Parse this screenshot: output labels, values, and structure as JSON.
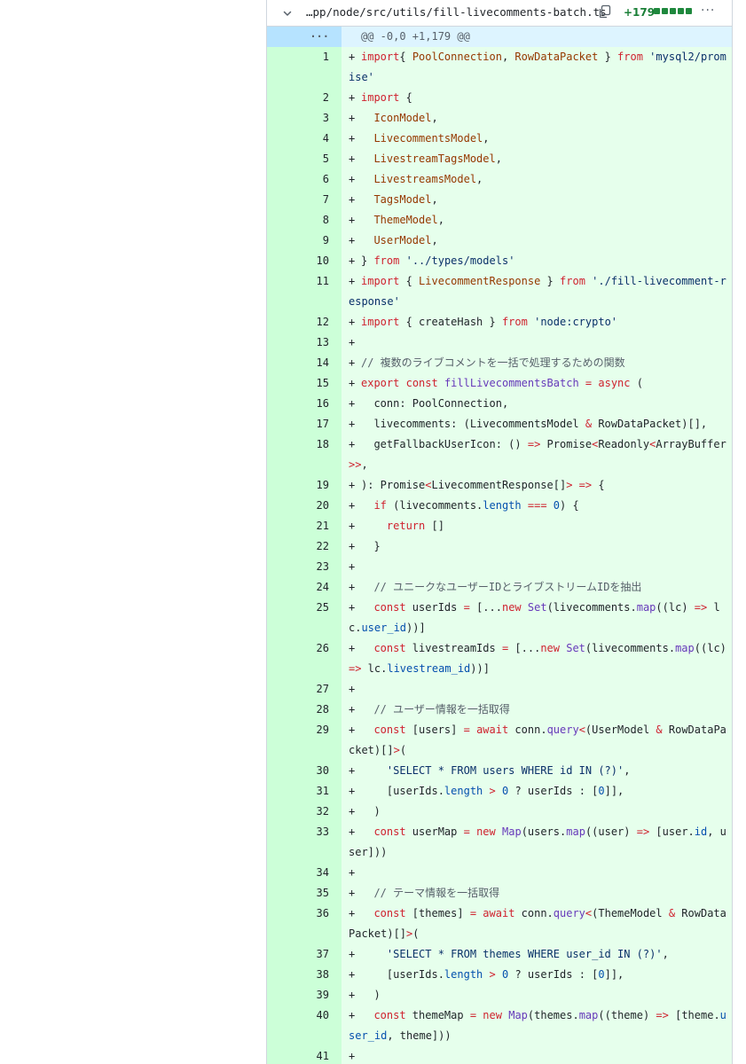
{
  "file": {
    "name": "…pp/node/src/utils/fill-livecomments-batch.ts",
    "additions": "+179",
    "more": "···"
  },
  "hunk": {
    "num": "···",
    "header": "@@ -0,0 +1,179 @@"
  },
  "lines": [
    {
      "n": "1",
      "tokens": [
        [
          "k",
          "import"
        ],
        [
          "",
          "{ "
        ],
        [
          "t",
          "PoolConnection"
        ],
        [
          "",
          ", "
        ],
        [
          "t",
          "RowDataPacket"
        ],
        [
          "",
          " } "
        ],
        [
          "k",
          "from"
        ],
        [
          "",
          " "
        ],
        [
          "s",
          "'mysql2/promise'"
        ]
      ]
    },
    {
      "n": "2",
      "tokens": [
        [
          "k",
          "import"
        ],
        [
          "",
          " {"
        ]
      ]
    },
    {
      "n": "3",
      "tokens": [
        [
          "",
          "  "
        ],
        [
          "t",
          "IconModel"
        ],
        [
          "",
          ","
        ]
      ]
    },
    {
      "n": "4",
      "tokens": [
        [
          "",
          "  "
        ],
        [
          "t",
          "LivecommentsModel"
        ],
        [
          "",
          ","
        ]
      ]
    },
    {
      "n": "5",
      "tokens": [
        [
          "",
          "  "
        ],
        [
          "t",
          "LivestreamTagsModel"
        ],
        [
          "",
          ","
        ]
      ]
    },
    {
      "n": "6",
      "tokens": [
        [
          "",
          "  "
        ],
        [
          "t",
          "LivestreamsModel"
        ],
        [
          "",
          ","
        ]
      ]
    },
    {
      "n": "7",
      "tokens": [
        [
          "",
          "  "
        ],
        [
          "t",
          "TagsModel"
        ],
        [
          "",
          ","
        ]
      ]
    },
    {
      "n": "8",
      "tokens": [
        [
          "",
          "  "
        ],
        [
          "t",
          "ThemeModel"
        ],
        [
          "",
          ","
        ]
      ]
    },
    {
      "n": "9",
      "tokens": [
        [
          "",
          "  "
        ],
        [
          "t",
          "UserModel"
        ],
        [
          "",
          ","
        ]
      ]
    },
    {
      "n": "10",
      "tokens": [
        [
          "",
          "} "
        ],
        [
          "k",
          "from"
        ],
        [
          "",
          " "
        ],
        [
          "s",
          "'../types/models'"
        ]
      ]
    },
    {
      "n": "11",
      "tokens": [
        [
          "k",
          "import"
        ],
        [
          "",
          " { "
        ],
        [
          "t",
          "LivecommentResponse"
        ],
        [
          "",
          " } "
        ],
        [
          "k",
          "from"
        ],
        [
          "",
          " "
        ],
        [
          "s",
          "'./fill-livecomment-response'"
        ]
      ]
    },
    {
      "n": "12",
      "tokens": [
        [
          "k",
          "import"
        ],
        [
          "",
          " { createHash } "
        ],
        [
          "k",
          "from"
        ],
        [
          "",
          " "
        ],
        [
          "s",
          "'node:crypto'"
        ]
      ]
    },
    {
      "n": "13",
      "tokens": []
    },
    {
      "n": "14",
      "tokens": [
        [
          "c",
          "// 複数のライブコメントを一括で処理するための関数"
        ]
      ]
    },
    {
      "n": "15",
      "tokens": [
        [
          "k",
          "export"
        ],
        [
          "",
          " "
        ],
        [
          "k",
          "const"
        ],
        [
          "",
          " "
        ],
        [
          "f",
          "fillLivecommentsBatch"
        ],
        [
          "",
          " "
        ],
        [
          "k",
          "="
        ],
        [
          "",
          " "
        ],
        [
          "k",
          "async"
        ],
        [
          "",
          " ("
        ]
      ]
    },
    {
      "n": "16",
      "tokens": [
        [
          "",
          "  conn: PoolConnection,"
        ]
      ]
    },
    {
      "n": "17",
      "tokens": [
        [
          "",
          "  livecomments: (LivecommentsModel "
        ],
        [
          "k",
          "&"
        ],
        [
          "",
          " RowDataPacket)[],"
        ]
      ]
    },
    {
      "n": "18",
      "tokens": [
        [
          "",
          "  getFallbackUserIcon: () "
        ],
        [
          "k",
          "=>"
        ],
        [
          "",
          " Promise"
        ],
        [
          "k",
          "<"
        ],
        [
          "",
          "Readonly"
        ],
        [
          "k",
          "<"
        ],
        [
          "",
          "ArrayBuffer"
        ],
        [
          "k",
          ">>"
        ],
        [
          "",
          ","
        ]
      ]
    },
    {
      "n": "19",
      "tokens": [
        [
          "",
          "): Promise"
        ],
        [
          "k",
          "<"
        ],
        [
          "",
          "LivecommentResponse[]"
        ],
        [
          "k",
          ">"
        ],
        [
          "",
          " "
        ],
        [
          "k",
          "=>"
        ],
        [
          "",
          " {"
        ]
      ]
    },
    {
      "n": "20",
      "tokens": [
        [
          "",
          "  "
        ],
        [
          "k",
          "if"
        ],
        [
          "",
          " (livecomments."
        ],
        [
          "n",
          "length"
        ],
        [
          "",
          " "
        ],
        [
          "k",
          "==="
        ],
        [
          "",
          " "
        ],
        [
          "n",
          "0"
        ],
        [
          "",
          ") {"
        ]
      ]
    },
    {
      "n": "21",
      "tokens": [
        [
          "",
          "    "
        ],
        [
          "k",
          "return"
        ],
        [
          "",
          " []"
        ]
      ]
    },
    {
      "n": "22",
      "tokens": [
        [
          "",
          "  }"
        ]
      ]
    },
    {
      "n": "23",
      "tokens": []
    },
    {
      "n": "24",
      "tokens": [
        [
          "",
          "  "
        ],
        [
          "c",
          "// ユニークなユーザーIDとライブストリームIDを抽出"
        ]
      ]
    },
    {
      "n": "25",
      "tokens": [
        [
          "",
          "  "
        ],
        [
          "k",
          "const"
        ],
        [
          "",
          " userIds "
        ],
        [
          "k",
          "="
        ],
        [
          "",
          " [..."
        ],
        [
          "k",
          "new"
        ],
        [
          "",
          " "
        ],
        [
          "f",
          "Set"
        ],
        [
          "",
          "(livecomments."
        ],
        [
          "f",
          "map"
        ],
        [
          "",
          "((lc) "
        ],
        [
          "k",
          "=>"
        ],
        [
          "",
          " lc."
        ],
        [
          "n",
          "user_id"
        ],
        [
          "",
          "))]"
        ]
      ]
    },
    {
      "n": "26",
      "tokens": [
        [
          "",
          "  "
        ],
        [
          "k",
          "const"
        ],
        [
          "",
          " livestreamIds "
        ],
        [
          "k",
          "="
        ],
        [
          "",
          " [..."
        ],
        [
          "k",
          "new"
        ],
        [
          "",
          " "
        ],
        [
          "f",
          "Set"
        ],
        [
          "",
          "(livecomments."
        ],
        [
          "f",
          "map"
        ],
        [
          "",
          "((lc) "
        ],
        [
          "k",
          "=>"
        ],
        [
          "",
          " lc."
        ],
        [
          "n",
          "livestream_id"
        ],
        [
          "",
          "))]"
        ]
      ]
    },
    {
      "n": "27",
      "tokens": []
    },
    {
      "n": "28",
      "tokens": [
        [
          "",
          "  "
        ],
        [
          "c",
          "// ユーザー情報を一括取得"
        ]
      ]
    },
    {
      "n": "29",
      "tokens": [
        [
          "",
          "  "
        ],
        [
          "k",
          "const"
        ],
        [
          "",
          " [users] "
        ],
        [
          "k",
          "="
        ],
        [
          "",
          " "
        ],
        [
          "k",
          "await"
        ],
        [
          "",
          " conn."
        ],
        [
          "f",
          "query"
        ],
        [
          "k",
          "<"
        ],
        [
          "",
          "(UserModel "
        ],
        [
          "k",
          "&"
        ],
        [
          "",
          " RowDataPacket)[]"
        ],
        [
          "k",
          ">"
        ],
        [
          "",
          "("
        ]
      ]
    },
    {
      "n": "30",
      "tokens": [
        [
          "",
          "    "
        ],
        [
          "s",
          "'SELECT * FROM users WHERE id IN (?)'"
        ],
        [
          "",
          ","
        ]
      ]
    },
    {
      "n": "31",
      "tokens": [
        [
          "",
          "    [userIds."
        ],
        [
          "n",
          "length"
        ],
        [
          "",
          " "
        ],
        [
          "k",
          ">"
        ],
        [
          "",
          " "
        ],
        [
          "n",
          "0"
        ],
        [
          "",
          " ? userIds : ["
        ],
        [
          "n",
          "0"
        ],
        [
          "",
          "]],"
        ]
      ]
    },
    {
      "n": "32",
      "tokens": [
        [
          "",
          "  )"
        ]
      ]
    },
    {
      "n": "33",
      "tokens": [
        [
          "",
          "  "
        ],
        [
          "k",
          "const"
        ],
        [
          "",
          " userMap "
        ],
        [
          "k",
          "="
        ],
        [
          "",
          " "
        ],
        [
          "k",
          "new"
        ],
        [
          "",
          " "
        ],
        [
          "f",
          "Map"
        ],
        [
          "",
          "(users."
        ],
        [
          "f",
          "map"
        ],
        [
          "",
          "((user) "
        ],
        [
          "k",
          "=>"
        ],
        [
          "",
          " [user."
        ],
        [
          "n",
          "id"
        ],
        [
          "",
          ", user]))"
        ]
      ]
    },
    {
      "n": "34",
      "tokens": []
    },
    {
      "n": "35",
      "tokens": [
        [
          "",
          "  "
        ],
        [
          "c",
          "// テーマ情報を一括取得"
        ]
      ]
    },
    {
      "n": "36",
      "tokens": [
        [
          "",
          "  "
        ],
        [
          "k",
          "const"
        ],
        [
          "",
          " [themes] "
        ],
        [
          "k",
          "="
        ],
        [
          "",
          " "
        ],
        [
          "k",
          "await"
        ],
        [
          "",
          " conn."
        ],
        [
          "f",
          "query"
        ],
        [
          "k",
          "<"
        ],
        [
          "",
          "(ThemeModel "
        ],
        [
          "k",
          "&"
        ],
        [
          "",
          " RowDataPacket)[]"
        ],
        [
          "k",
          ">"
        ],
        [
          "",
          "("
        ]
      ]
    },
    {
      "n": "37",
      "tokens": [
        [
          "",
          "    "
        ],
        [
          "s",
          "'SELECT * FROM themes WHERE user_id IN (?)'"
        ],
        [
          "",
          ","
        ]
      ]
    },
    {
      "n": "38",
      "tokens": [
        [
          "",
          "    [userIds."
        ],
        [
          "n",
          "length"
        ],
        [
          "",
          " "
        ],
        [
          "k",
          ">"
        ],
        [
          "",
          " "
        ],
        [
          "n",
          "0"
        ],
        [
          "",
          " ? userIds : ["
        ],
        [
          "n",
          "0"
        ],
        [
          "",
          "]],"
        ]
      ]
    },
    {
      "n": "39",
      "tokens": [
        [
          "",
          "  )"
        ]
      ]
    },
    {
      "n": "40",
      "tokens": [
        [
          "",
          "  "
        ],
        [
          "k",
          "const"
        ],
        [
          "",
          " themeMap "
        ],
        [
          "k",
          "="
        ],
        [
          "",
          " "
        ],
        [
          "k",
          "new"
        ],
        [
          "",
          " "
        ],
        [
          "f",
          "Map"
        ],
        [
          "",
          "(themes."
        ],
        [
          "f",
          "map"
        ],
        [
          "",
          "((theme) "
        ],
        [
          "k",
          "=>"
        ],
        [
          "",
          " [theme."
        ],
        [
          "n",
          "user_id"
        ],
        [
          "",
          ", theme]))"
        ]
      ]
    },
    {
      "n": "41",
      "tokens": []
    }
  ]
}
